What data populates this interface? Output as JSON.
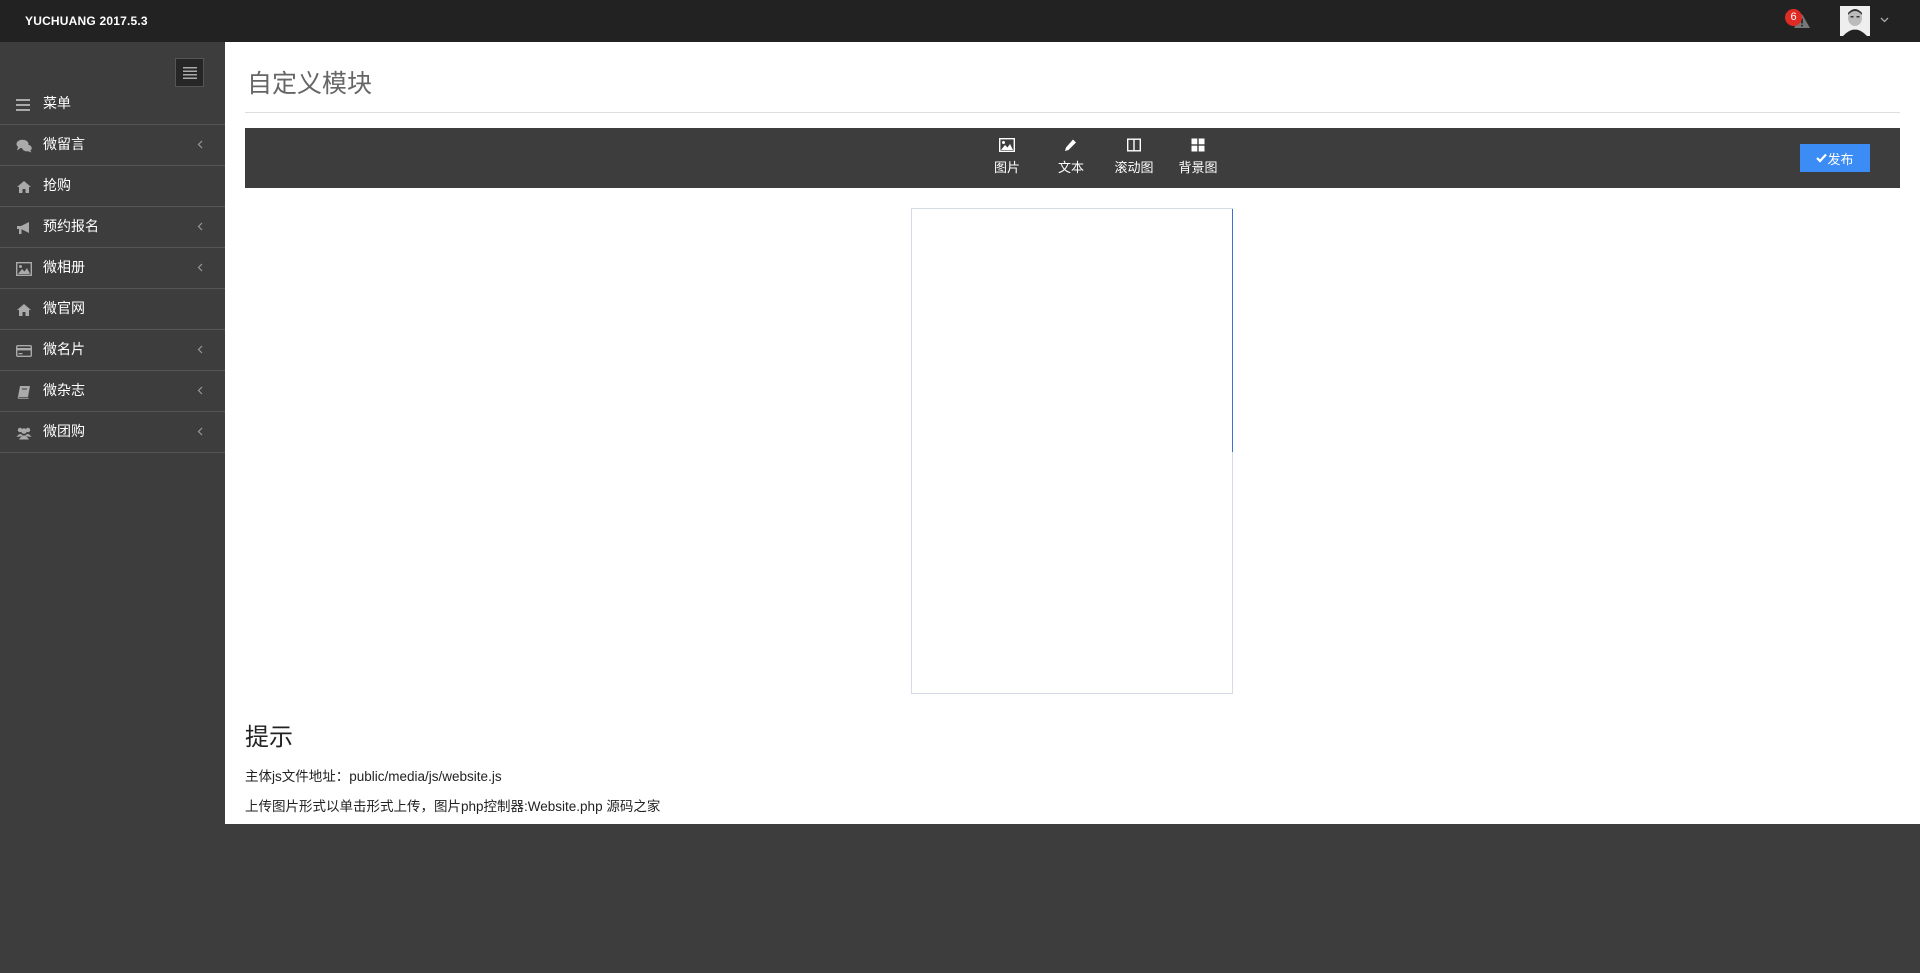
{
  "header": {
    "brand": "YUCHUANG  2017.5.3",
    "alert_count": "6"
  },
  "sidebar": {
    "items": [
      {
        "label": "菜单",
        "icon": "bars-icon",
        "has_arrow": false
      },
      {
        "label": "微留言",
        "icon": "comments-icon",
        "has_arrow": true
      },
      {
        "label": "抢购",
        "icon": "home-icon",
        "has_arrow": false
      },
      {
        "label": "预约报名",
        "icon": "bullhorn-icon",
        "has_arrow": true
      },
      {
        "label": "微相册",
        "icon": "picture-icon",
        "has_arrow": true
      },
      {
        "label": "微官网",
        "icon": "home-icon",
        "has_arrow": false
      },
      {
        "label": "微名片",
        "icon": "credit-card-icon",
        "has_arrow": true
      },
      {
        "label": "微杂志",
        "icon": "book-icon",
        "has_arrow": true
      },
      {
        "label": "微团购",
        "icon": "users-icon",
        "has_arrow": true
      }
    ]
  },
  "main": {
    "title": "自定义模块",
    "toolbar": {
      "tools": [
        {
          "label": "图片",
          "icon": "picture-icon"
        },
        {
          "label": "文本",
          "icon": "pencil-icon"
        },
        {
          "label": "滚动图",
          "icon": "columns-icon"
        },
        {
          "label": "背景图",
          "icon": "th-large-icon"
        }
      ],
      "publish_label": "发布"
    },
    "tips": {
      "title": "提示",
      "lines": [
        "主体js文件地址：public/media/js/website.js",
        "上传图片形式以单击形式上传，图片php控制器:Website.php 源码之家"
      ]
    }
  },
  "colors": {
    "topbar": "#222222",
    "sidebar": "#3d3d3d",
    "accent": "#3b8cf5",
    "badge": "#e02a24"
  }
}
